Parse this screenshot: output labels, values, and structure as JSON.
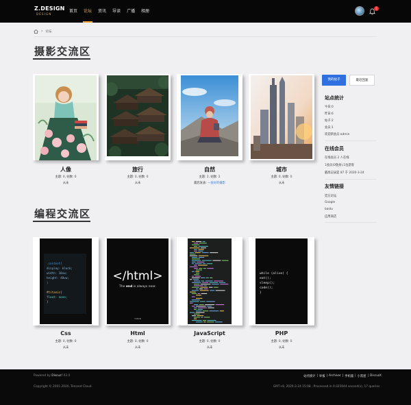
{
  "header": {
    "logo": "Z.DESIGN",
    "logo_sub": "DESIGN",
    "nav": [
      "首页",
      "论坛",
      "资讯",
      "导读",
      "广播",
      "相册"
    ],
    "active_nav": "论坛",
    "notification_count": "1"
  },
  "breadcrumb": {
    "current": "论坛"
  },
  "photo_section": {
    "title": "摄影交流区",
    "boards": [
      {
        "name": "人像",
        "stats": "主题: 0, 帖数: 0",
        "last": "从未"
      },
      {
        "name": "旅行",
        "stats": "主题: 0, 帖数: 0",
        "last": "从未"
      },
      {
        "name": "自然",
        "stats": "主题: 2, 帖数: 2",
        "last_label": "最后发表:",
        "last_link": "一张好的摄影"
      },
      {
        "name": "城市",
        "stats": "主题: 0, 帖数: 0",
        "last": "从未"
      }
    ]
  },
  "code_section": {
    "title": "编程交流区",
    "boards": [
      {
        "name": "Css",
        "stats": "主题: 0, 帖数: 0",
        "last": "从未"
      },
      {
        "name": "Html",
        "stats": "主题: 0, 帖数: 0",
        "last": "从未"
      },
      {
        "name": "JavaScript",
        "stats": "主题: 0, 帖数: 0",
        "last": "从未"
      },
      {
        "name": "PHP",
        "stats": "主题: 0, 帖数: 0",
        "last": "从未"
      }
    ],
    "css_code": [
      ".content{",
      "display: block;",
      "width: 10vw;",
      "height: 40vw;",
      "}",
      "",
      "#titanic{",
      "  float: none;",
      "}"
    ],
    "html_big": "</html>",
    "html_tag_pre": "The ",
    "html_tag_bold": "end",
    "html_tag_post": " is always near.",
    "html_brand": "YABAN",
    "php_code": [
      "while (alive) {",
      "    eat();",
      "    sleep();",
      "    code();",
      "}"
    ]
  },
  "sidebar": {
    "my_posts": "我的帖子",
    "my_replies": "最近回复",
    "site_stats_title": "站点统计",
    "site_stats": [
      "今日:0",
      "昨日:6",
      "帖子:2",
      "会员:1",
      "欢迎新会员:admin"
    ],
    "online_title": "在线会员",
    "online": [
      "在线会员 2 人在线",
      "1会员(0隐身),1位游客",
      "最高记录是 87 于 2020-3-24"
    ],
    "links_title": "友情链接",
    "links": [
      "官方论坛",
      "Google",
      "baidu",
      "应用商店"
    ]
  },
  "footer": {
    "powered_pre": "Powered by ",
    "powered_name": "Discuz!",
    "powered_ver": " X3.4",
    "copyright": "Copyright © 2001-2020, Tencent Cloud.",
    "links": [
      "站点统计",
      "|",
      "举报",
      "|",
      "Archiver",
      "|",
      "手机版",
      "|",
      "小黑屋",
      "|",
      "DiscuzX"
    ],
    "gmt": "GMT+8, 2020-3-24 15:08 , Processed in 0.025944 second(s), 17 queries ."
  }
}
